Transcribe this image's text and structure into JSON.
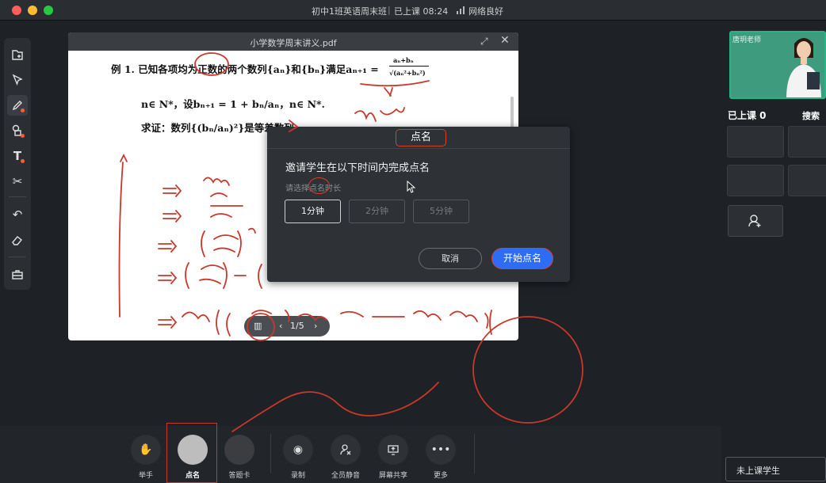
{
  "window": {
    "title": "初中1班英语周末班",
    "separator": "|",
    "class_status": "已上课 08:24",
    "network": "网络良好"
  },
  "toolbar": {
    "tools": [
      "import-icon",
      "select-icon",
      "pen-icon",
      "shapes-icon",
      "text-icon",
      "scissors-icon",
      "undo-icon",
      "eraser-icon",
      "toolbox-icon"
    ]
  },
  "pdf": {
    "filename": "小学数学周末讲义.pdf",
    "line1": "例 1. 已知各项均为正数的两个数列{aₙ}和{bₙ}满足aₙ₊₁ =",
    "frac_top": "aₙ+bₙ",
    "frac_bottom": "√(aₙ²+bₙ²)",
    "line2": "n∈ N*，设bₙ₊₁ = 1 + bₙ/aₙ，n∈ N*.",
    "line3": "求证：数列{(bₙ/aₙ)²}是等差数列",
    "pager": {
      "current": "1/5"
    }
  },
  "dialog": {
    "title": "点名",
    "prompt": "邀请学生在以下时间内完成点名",
    "sub_label": "请选择点名时长",
    "durations": [
      {
        "label": "1分钟",
        "selected": true
      },
      {
        "label": "2分钟",
        "selected": false
      },
      {
        "label": "5分钟",
        "selected": false
      }
    ],
    "cancel": "取消",
    "start": "开始点名"
  },
  "right_panel": {
    "teacher_name": "唐玥老师",
    "status_count": "已上课 0",
    "search": "搜索",
    "not_joined": "未上课学生"
  },
  "bottom": {
    "items": [
      {
        "label": "举手",
        "icon": "raise-hand-icon"
      },
      {
        "label": "点名",
        "icon": "roll-call-icon"
      },
      {
        "label": "答题卡",
        "icon": "answer-card-icon"
      },
      {
        "label": "录制",
        "icon": "record-icon"
      },
      {
        "label": "全员静音",
        "icon": "mute-all-icon"
      },
      {
        "label": "屏幕共享",
        "icon": "screen-share-icon"
      },
      {
        "label": "更多",
        "icon": "more-icon"
      }
    ]
  },
  "colors": {
    "accent": "#2f6cf6",
    "annotation": "#c8392b",
    "background": "#1e2125"
  }
}
